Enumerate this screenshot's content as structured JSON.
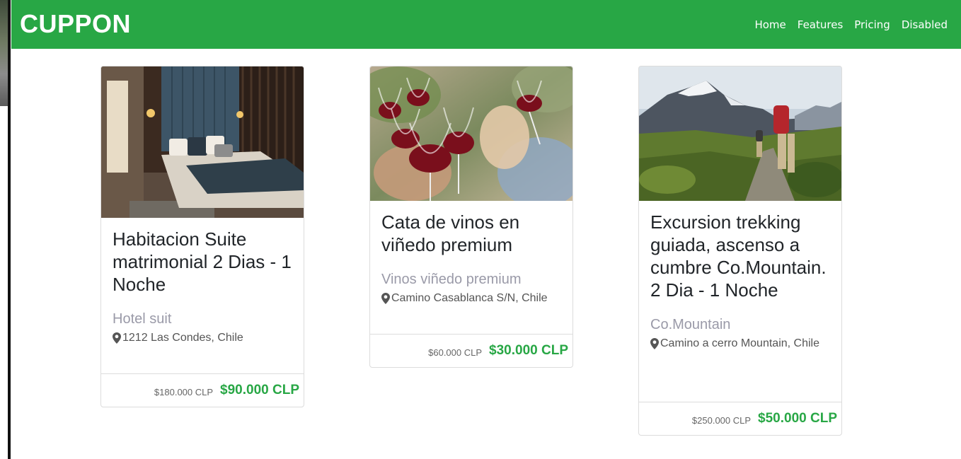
{
  "brand": "CUPPON",
  "nav": {
    "items": [
      "Home",
      "Features",
      "Pricing",
      "Disabled"
    ]
  },
  "colors": {
    "navbar": "#28a745",
    "price": "#28a745",
    "subtitle": "#9a9aa8"
  },
  "cards": [
    {
      "image": "hotel-room-photo",
      "title": "Habitacion Suite matrimonial 2 Dias - 1 Noche",
      "subtitle": "Hotel suit",
      "location": "1212 Las Condes, Chile",
      "old_price": "$180.000 CLP",
      "new_price": "$90.000 CLP"
    },
    {
      "image": "wine-glasses-photo",
      "title": "Cata de vinos en viñedo premium",
      "subtitle": "Vinos viñedo premium",
      "location": "Camino Casablanca S/N, Chile",
      "old_price": "$60.000 CLP",
      "new_price": "$30.000 CLP"
    },
    {
      "image": "mountain-trekking-photo",
      "title": "Excursion trekking guiada, ascenso a cumbre Co.Mountain. 2 Dia - 1 Noche",
      "subtitle": "Co.Mountain",
      "location": "Camino a cerro Mountain, Chile",
      "old_price": "$250.000 CLP",
      "new_price": "$50.000 CLP"
    }
  ]
}
